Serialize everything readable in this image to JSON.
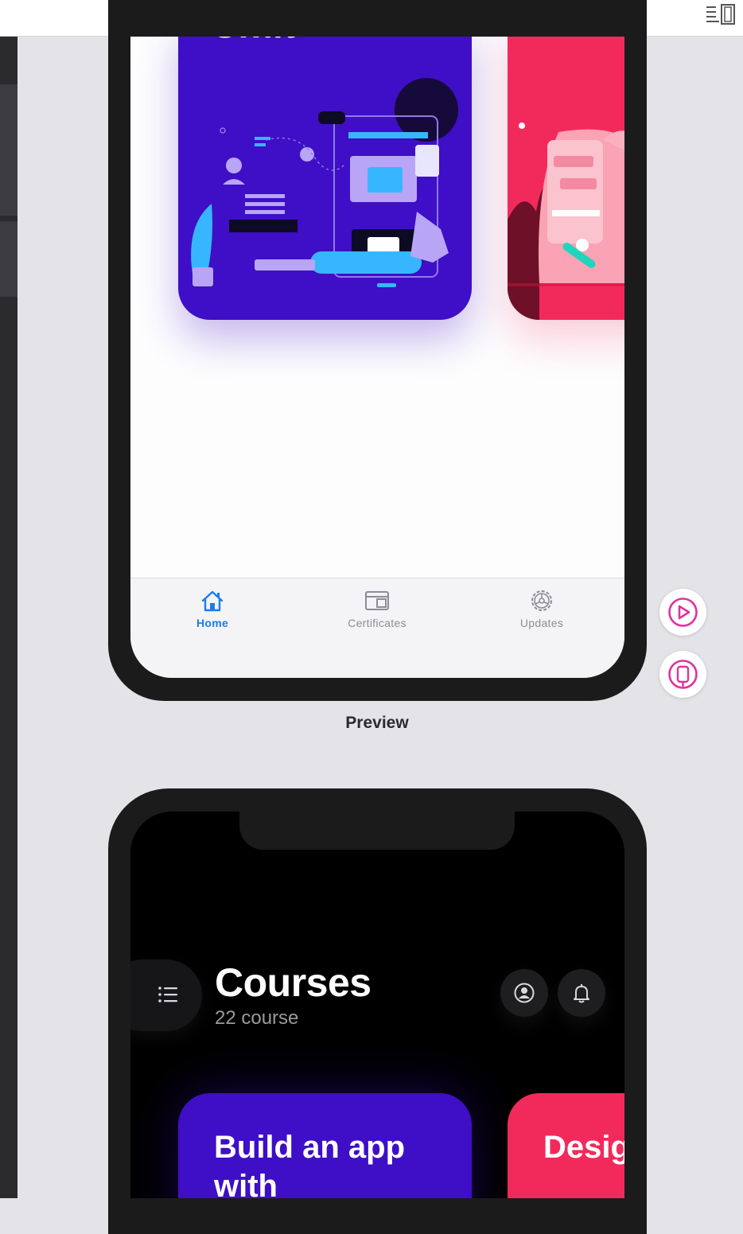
{
  "tabbar": {
    "tabs": [
      {
        "label": "Home",
        "icon": "house-icon",
        "active": true
      },
      {
        "label": "Certificates",
        "icon": "certificate-frame-icon",
        "active": false
      },
      {
        "label": "Updates",
        "icon": "gear-icon",
        "active": false
      }
    ]
  },
  "preview": {
    "label": "Preview",
    "card_title_peek": "Swift"
  },
  "courses_screen": {
    "title": "Courses",
    "subtitle": "22 course",
    "cards": [
      {
        "title": "Build an app with",
        "color": "#3e0fc6"
      },
      {
        "title": "Design Course",
        "color": "#f22a5c"
      }
    ]
  },
  "colors": {
    "accent_blue": "#1a7cf0",
    "card_blue": "#3e0fc6",
    "card_pink": "#f22a5c",
    "fab_accent": "#e0329e"
  },
  "icons": {
    "toolbar": "layout-toggle-icon",
    "fab_play": "play-icon",
    "fab_device": "device-icon",
    "menu": "list-icon",
    "profile": "profile-icon",
    "bell": "bell-icon"
  }
}
